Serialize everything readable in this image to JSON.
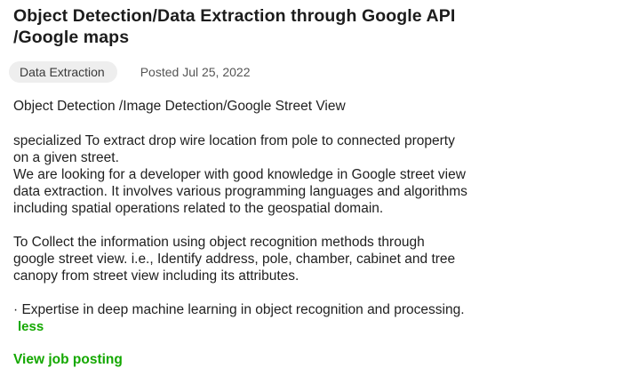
{
  "job": {
    "title_line1": "Object Detection/Data Extraction through Google API",
    "title_line2": "/Google maps",
    "tag": "Data Extraction",
    "posted": "Posted Jul 25, 2022",
    "subtitle": "Object Detection /Image Detection/Google Street View",
    "description": {
      "p1_line1": "specialized To extract drop wire location from pole to connected property",
      "p1_line2": "on a given street.",
      "p2_line1": "We are looking for a developer with good knowledge in Google street view",
      "p2_line2": "data extraction. It involves various programming languages and algorithms",
      "p2_line3": "including spatial operations related to the geospatial domain.",
      "p3_line1": "To Collect the information using object recognition methods through",
      "p3_line2": "google street view. i.e., Identify address, pole, chamber, cabinet and tree",
      "p3_line3": "canopy from street view including its attributes.",
      "p4_line1": "· Expertise in deep machine learning in object recognition and processing."
    },
    "less_label": "less",
    "view_label": "View job posting"
  },
  "colors": {
    "accent": "#14a800",
    "tag_bg": "#eeeeee",
    "text": "#1f1f1f"
  }
}
